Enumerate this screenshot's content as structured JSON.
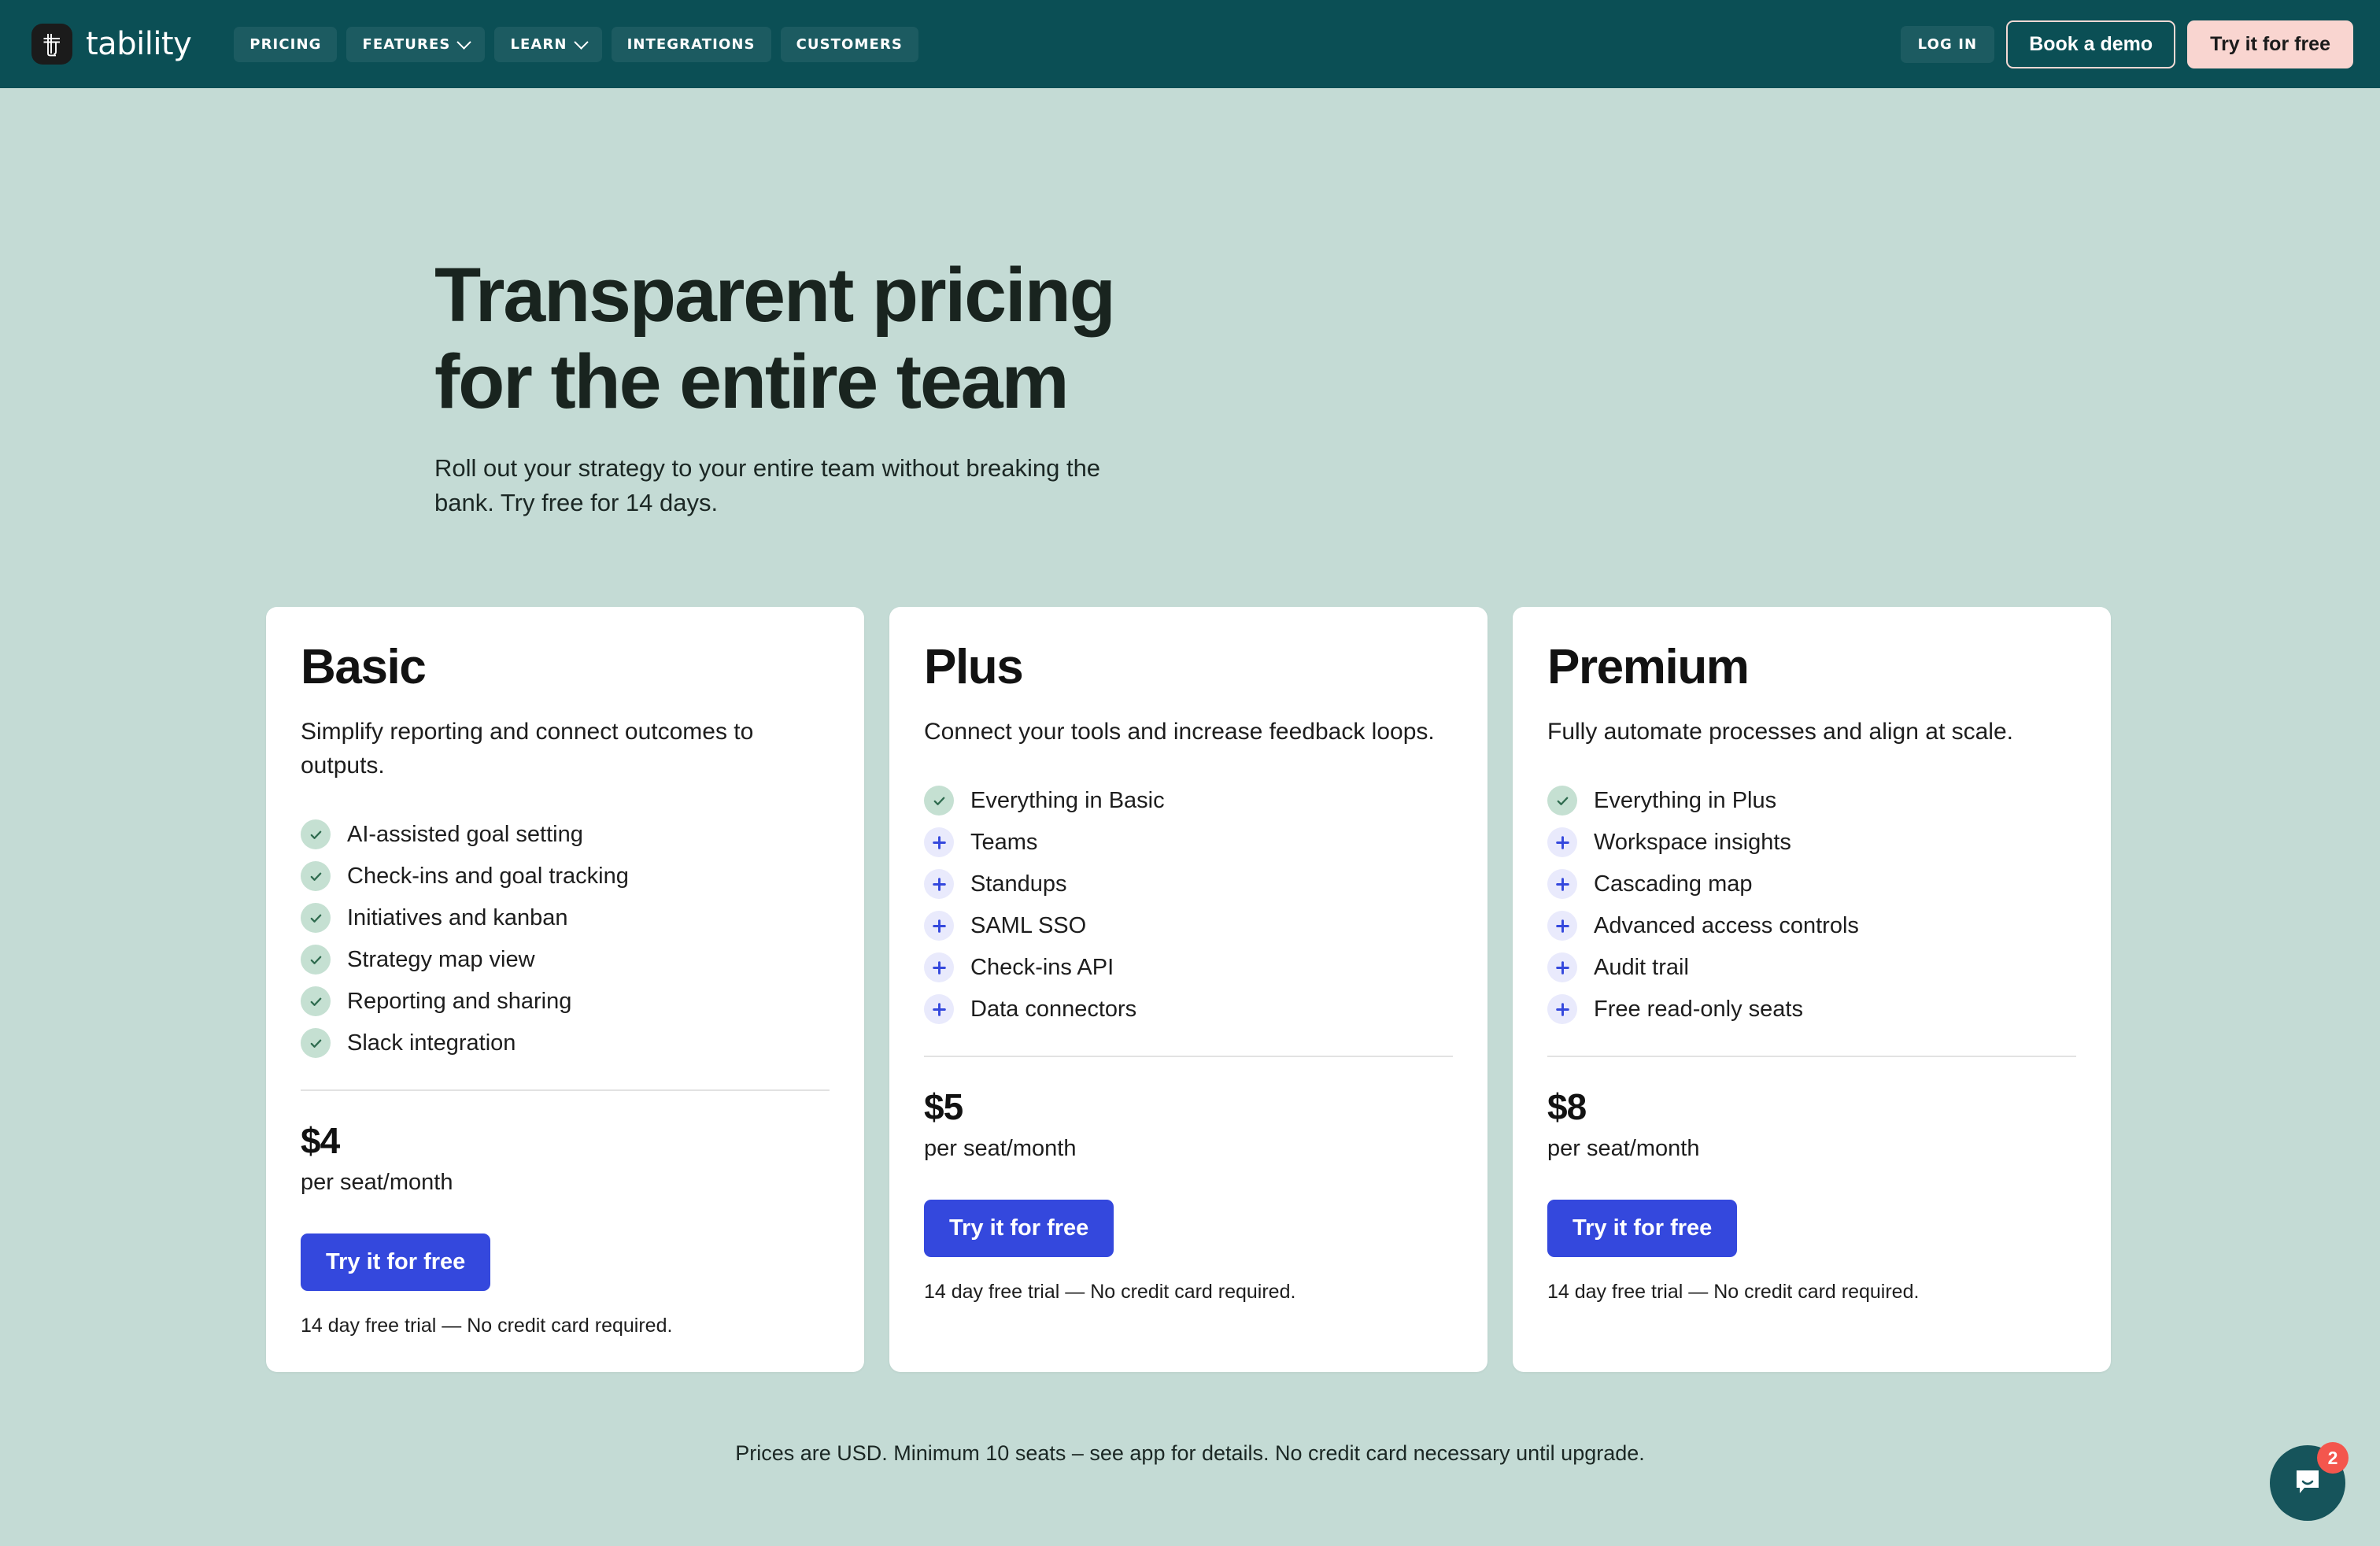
{
  "theme": {
    "page_background": "#c4dbd5",
    "navbar_background": "#0b4f55",
    "card_background": "#ffffff",
    "primary_button": "#3448dd",
    "accent_pink": "#f9d5d0",
    "check_icon_background": "#c5e0d2",
    "plus_icon_background": "#e9eafc",
    "plus_icon_color": "#3448dd",
    "intercom_background": "#16545b",
    "intercom_badge_color": "#f4564d"
  },
  "navbar": {
    "brand_name": "tability",
    "logo_icon": "tability-logo-icon",
    "links": [
      {
        "label": "PRICING",
        "has_chevron": false
      },
      {
        "label": "FEATURES",
        "has_chevron": true
      },
      {
        "label": "LEARN",
        "has_chevron": true
      },
      {
        "label": "INTEGRATIONS",
        "has_chevron": false
      },
      {
        "label": "CUSTOMERS",
        "has_chevron": false
      }
    ],
    "login_label": "LOG IN",
    "demo_label": "Book a demo",
    "try_label": "Try it for free"
  },
  "hero": {
    "heading_line1": "Transparent pricing",
    "heading_line2": "for the entire team",
    "subheading": "Roll out your strategy to your entire team without breaking the bank. Try free for 14 days."
  },
  "plans": [
    {
      "name": "Basic",
      "description": "Simplify reporting and connect outcomes to outputs.",
      "features": [
        {
          "icon": "check-icon",
          "label": "AI-assisted goal setting"
        },
        {
          "icon": "check-icon",
          "label": "Check-ins and goal tracking"
        },
        {
          "icon": "check-icon",
          "label": "Initiatives and kanban"
        },
        {
          "icon": "check-icon",
          "label": "Strategy map view"
        },
        {
          "icon": "check-icon",
          "label": "Reporting and sharing"
        },
        {
          "icon": "check-icon",
          "label": "Slack integration"
        }
      ],
      "price": "$4",
      "price_unit": "per seat/month",
      "cta_label": "Try it for free",
      "trial_note": "14 day free trial — No credit card required."
    },
    {
      "name": "Plus",
      "description": "Connect your tools and increase feedback loops.",
      "features": [
        {
          "icon": "check-icon",
          "label": "Everything in Basic"
        },
        {
          "icon": "plus-icon",
          "label": "Teams"
        },
        {
          "icon": "plus-icon",
          "label": "Standups"
        },
        {
          "icon": "plus-icon",
          "label": "SAML SSO"
        },
        {
          "icon": "plus-icon",
          "label": "Check-ins API"
        },
        {
          "icon": "plus-icon",
          "label": "Data connectors"
        }
      ],
      "price": "$5",
      "price_unit": "per seat/month",
      "cta_label": "Try it for free",
      "trial_note": "14 day free trial — No credit card required."
    },
    {
      "name": "Premium",
      "description": "Fully automate processes and align at scale.",
      "features": [
        {
          "icon": "check-icon",
          "label": "Everything in Plus"
        },
        {
          "icon": "plus-icon",
          "label": "Workspace insights"
        },
        {
          "icon": "plus-icon",
          "label": "Cascading map"
        },
        {
          "icon": "plus-icon",
          "label": "Advanced access controls"
        },
        {
          "icon": "plus-icon",
          "label": "Audit trail"
        },
        {
          "icon": "plus-icon",
          "label": "Free read-only seats"
        }
      ],
      "price": "$8",
      "price_unit": "per seat/month",
      "cta_label": "Try it for free",
      "trial_note": "14 day free trial — No credit card required."
    }
  ],
  "footnote": "Prices are USD. Minimum 10 seats – see app for details. No credit card necessary until upgrade.",
  "intercom": {
    "icon": "chat-bubble-icon",
    "badge_count": "2"
  }
}
